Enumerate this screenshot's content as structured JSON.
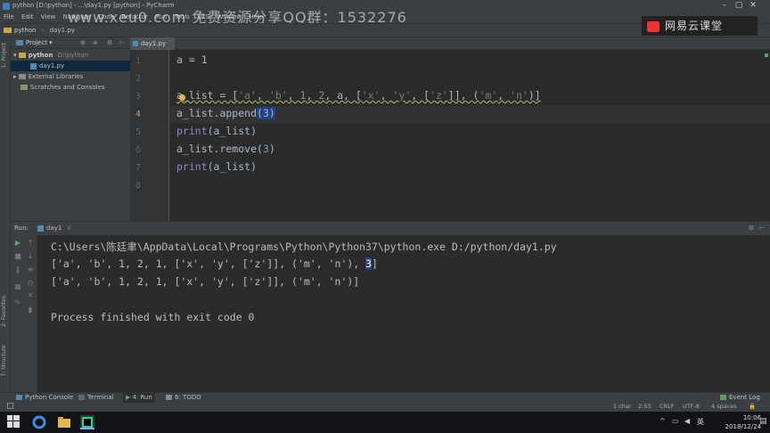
{
  "titlebar": {
    "text": "python [D:\\python] - ...\\day1.py [python] - PyCharm"
  },
  "watermark": "www.xeu0.com 免费资源分享QQ群：1532276",
  "menu": {
    "items": [
      "File",
      "Edit",
      "View",
      "Navigate",
      "Code",
      "Refactor",
      "Run",
      "Tools",
      "VCS",
      "Window",
      "Help"
    ]
  },
  "nav": {
    "project": "python",
    "file": "day1.py"
  },
  "brand": "网易云课堂",
  "sidebar": {
    "project_label": "1: Project",
    "favorites_label": "2: Favorites",
    "structure_label": "7: Structure"
  },
  "project_panel": {
    "header": "Project",
    "tree": [
      {
        "label": "python",
        "hint": "D:\\python"
      },
      {
        "label": "day1.py"
      },
      {
        "label": "External Libraries"
      },
      {
        "label": "Scratches and Consoles"
      }
    ]
  },
  "editor": {
    "tab": "day1.py",
    "line_numbers": [
      "1",
      "2",
      "3",
      "4",
      "5",
      "6",
      "7",
      "8"
    ],
    "lines": [
      {
        "t1": "a = 1"
      },
      {},
      {
        "t1": "a_list = [",
        "s1": "'a'",
        "t2": ", ",
        "s2": "'b'",
        "t3": ", ",
        "n1": "1",
        "t4": ", ",
        "n2": "2",
        "t5": ", a, [",
        "s3": "'x'",
        "t6": ", ",
        "s4": "'y'",
        "t7": ", [",
        "s5": "'z'",
        "t8": "]], (",
        "s6": "'m'",
        "t9": ", ",
        "s7": "'n'",
        "t10": ")]"
      },
      {
        "t1": "a_list.append",
        "hl": "(3)"
      },
      {
        "kw": "print",
        "t1": "(a_list)"
      },
      {
        "t1": "a_list.remove(",
        "n1": "3",
        "t2": ")"
      },
      {
        "kw": "print",
        "t1": "(a_list)"
      },
      {}
    ]
  },
  "run": {
    "label": "Run:",
    "config": "day1",
    "output": [
      "C:\\Users\\陈廷聿\\AppData\\Local\\Programs\\Python\\Python37\\python.exe D:/python/day1.py",
      "['a', 'b', 1, 2, 1, ['x', 'y', ['z']], ('m', 'n'), ",
      "3",
      "]",
      "['a', 'b', 1, 2, 1, ['x', 'y', ['z']], ('m', 'n')]",
      "Process finished with exit code 0"
    ]
  },
  "bottom_tabs": [
    "Python Console",
    "Terminal",
    "4: Run",
    "6: TODO"
  ],
  "event_log": "Event Log",
  "status": {
    "selection": "1 char",
    "position": "2:53",
    "line_sep": "CRLF",
    "encoding": "UTF-8",
    "indent": "4 spaces"
  },
  "taskbar": {
    "time": "10:06",
    "date": "2018/12/24",
    "ime": "英"
  },
  "colors": {
    "accent": "#214283",
    "keyword": "#8888c6",
    "string": "#6a8759",
    "number": "#6897bb"
  }
}
